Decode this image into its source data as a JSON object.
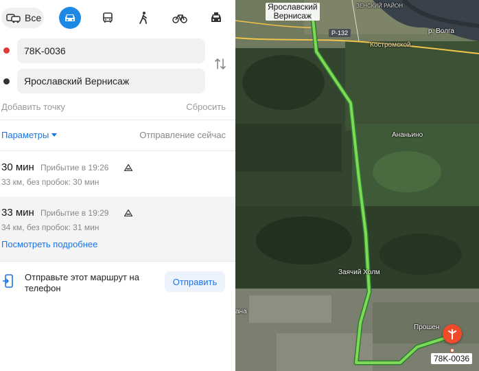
{
  "modes": {
    "all_label": "Все",
    "items": [
      "car-icon",
      "bus-icon",
      "walk-icon",
      "bike-icon",
      "taxi-icon"
    ],
    "active": "car-icon"
  },
  "from": {
    "value": "78K-0036"
  },
  "to": {
    "value": "Ярославский Вернисаж"
  },
  "add_point": "Добавить точку",
  "reset": "Сбросить",
  "params_label": "Параметры",
  "departure": "Отправление сейчас",
  "routes": [
    {
      "time": "30 мин",
      "arrival": "Прибытие в 19:26",
      "distance": "33 км, без пробок: 30 мин"
    },
    {
      "time": "33 мин",
      "arrival": "Прибытие в 19:29",
      "distance": "34 км, без пробок: 31 мин",
      "more": "Посмотреть подробнее"
    }
  ],
  "send": {
    "text": "Отправьте этот маршрут на телефон",
    "button": "Отправить"
  },
  "map": {
    "city_label_line1": "Ярославский",
    "city_label_line2": "Вернисаж",
    "road": "P-132",
    "river": "р. Волга",
    "kostroma": "Костромской",
    "district": "ЗЕНСКИЙ РАЙОН",
    "village1": "Ананьино",
    "village2": "Заячий Холм",
    "village3": "Прошен",
    "village4": "ана",
    "dest": "78K-0036"
  },
  "colors": {
    "accent": "#1e88e5",
    "route": "#7ed957",
    "pin": "#f04a2a"
  }
}
